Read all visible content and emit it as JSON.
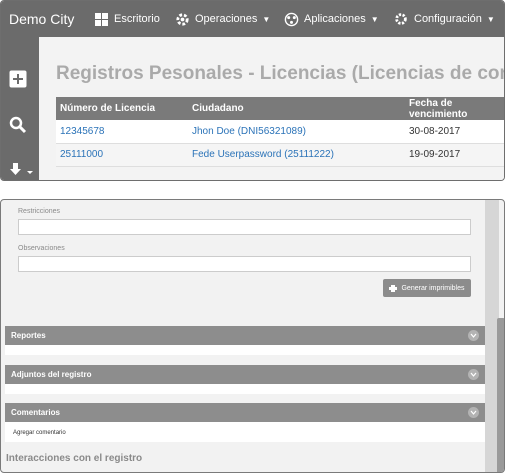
{
  "navbar": {
    "brand": "Demo City",
    "items": [
      {
        "label": "Escritorio",
        "icon": "dashboard-icon"
      },
      {
        "label": "Operaciones",
        "icon": "gear-icon"
      },
      {
        "label": "Aplicaciones",
        "icon": "network-icon"
      },
      {
        "label": "Configuración",
        "icon": "cog-icon"
      }
    ]
  },
  "sidebar": {
    "buttons": [
      {
        "icon": "plus-box-icon"
      },
      {
        "icon": "search-icon"
      },
      {
        "icon": "download-icon"
      }
    ]
  },
  "main": {
    "title": "Registros Pesonales - Licencias (Licencias de conducir)",
    "table": {
      "headers": [
        "Número de Licencia",
        "Ciudadano",
        "Fecha de vencimiento"
      ],
      "rows": [
        {
          "number": "12345678",
          "citizen": "Jhon Doe (DNI56321089)",
          "expiry": "30-08-2017"
        },
        {
          "number": "25111000",
          "citizen": "Fede Userpassword (25111222)",
          "expiry": "19-09-2017"
        }
      ]
    }
  },
  "form": {
    "restricciones_label": "Restricciones",
    "observaciones_label": "Observaciones",
    "generate_button": "Generar imprimibles"
  },
  "panels": {
    "reportes": "Reportes",
    "adjuntos": "Adjuntos del registro",
    "comentarios": "Comentarios",
    "add_comment": "Agregar comentario",
    "interacciones": "Interacciones con el registro"
  },
  "colors": {
    "navbar": "#6b6b6b",
    "link": "#2b73b8",
    "panel_header": "#8d8d8d"
  }
}
